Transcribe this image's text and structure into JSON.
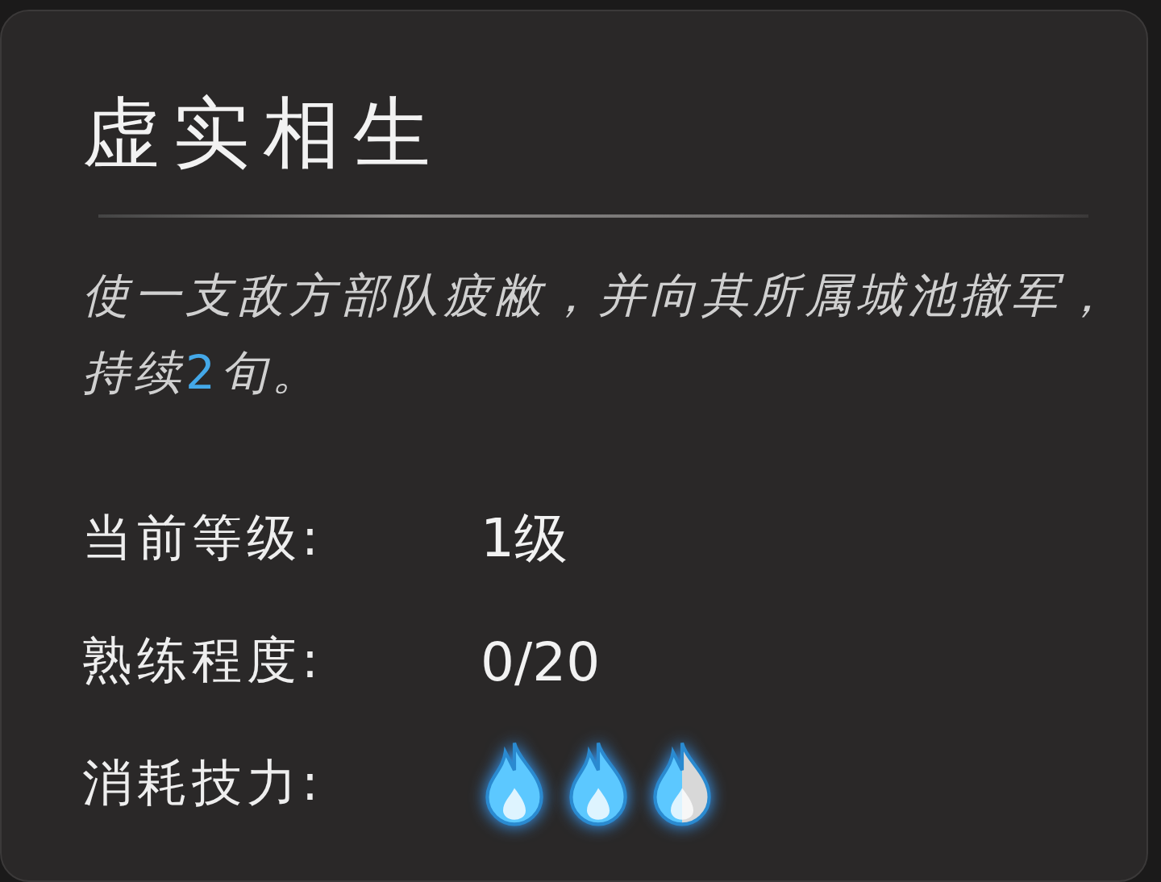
{
  "tooltip": {
    "title": "虚实相生",
    "description": [
      {
        "text": "使一支敌方部队疲敝，并向其所属城池撤军，持续",
        "highlight": false
      },
      {
        "text": "2",
        "highlight": true
      },
      {
        "text": "旬。",
        "highlight": false
      }
    ],
    "stats": [
      {
        "kind": "text",
        "label": "当前等级:",
        "value": "1级"
      },
      {
        "kind": "text",
        "label": "熟练程度:",
        "value": "0/20"
      },
      {
        "kind": "flames",
        "label": "消耗技力:",
        "flames": [
          {
            "kind": "full"
          },
          {
            "kind": "full"
          },
          {
            "kind": "half"
          }
        ]
      }
    ]
  }
}
